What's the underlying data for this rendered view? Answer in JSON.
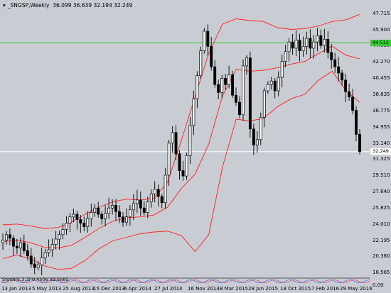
{
  "title": {
    "symbol": "_SNGSP,Weekly",
    "ohlc": "36.099 36.639 32.194 32.249"
  },
  "price_labels": [
    "47.715",
    "45.900",
    "44.090",
    "42.270",
    "40.455",
    "38.635",
    "36.775",
    "34.955",
    "33.140",
    "31.325",
    "29.510",
    "27.640",
    "25.825",
    "24.010",
    "22.195",
    "20.380",
    "18.565"
  ],
  "hline_green": {
    "label": "44.512",
    "value": 44.51,
    "color": "#33cc33"
  },
  "hline_white": {
    "label": "32.249",
    "value": 32.25,
    "color": "#ffffff"
  },
  "date_labels": [
    "13 Jan 2013",
    "5 May 2013",
    "25 Aug 2013",
    "15 Dec 2013",
    "6 Apr 2014",
    "27 Jul 2014",
    "16 Nov 2014",
    "8 Mar 2015",
    "28 Jun 2015",
    "18 Oct 2015",
    "7 Feb 2016",
    "29 May 2016"
  ],
  "indicator": {
    "label": "Stoch(5,3,3) 0.4506 33.5685",
    "zero_label": "0.00"
  },
  "colors": {
    "background": "#c9ccd2",
    "bull_candle": "#000000",
    "bear_candle": "#000000",
    "candle_body_bull": "#ffffff",
    "bands": "#ff2020",
    "wick": "#000000"
  },
  "chart_data": {
    "type": "candlestick",
    "title": "_SNGSP,Weekly",
    "ylim": [
      18.4,
      48.3
    ],
    "x": [
      "2013-01-13",
      "2016-06-19"
    ],
    "close_series": [
      22.3,
      22.9,
      22.5,
      21.6,
      21.4,
      22.0,
      21.1,
      20.5,
      19.6,
      19.2,
      19.5,
      20.3,
      20.9,
      21.2,
      21.8,
      22.4,
      22.9,
      23.5,
      24.2,
      24.9,
      25.2,
      24.6,
      24.2,
      23.8,
      24.7,
      25.4,
      25.9,
      25.2,
      24.7,
      25.3,
      25.9,
      26.2,
      25.5,
      24.9,
      24.3,
      24.9,
      25.7,
      26.4,
      26.8,
      25.9,
      25.4,
      26.6,
      27.5,
      28.0,
      27.2,
      26.5,
      29.6,
      33.2,
      34.4,
      32.0,
      30.1,
      29.5,
      31.8,
      35.2,
      38.2,
      40.8,
      43.6,
      45.8,
      44.1,
      41.8,
      39.8,
      38.9,
      40.5,
      39.8,
      40.9,
      38.6,
      37.8,
      36.4,
      41.9,
      42.8,
      34.8,
      33.0,
      33.6,
      36.1,
      39.1,
      39.8,
      40.2,
      39.1,
      40.6,
      42.4,
      43.5,
      44.6,
      43.9,
      44.8,
      43.6,
      44.1,
      45.0,
      43.9,
      44.6,
      45.3,
      44.2,
      44.9,
      43.4,
      42.6,
      41.8,
      41.1,
      40.3,
      39.0,
      38.4,
      36.9,
      34.2,
      32.25
    ],
    "bollinger_upper_approx": [
      24.0,
      24.1,
      23.9,
      23.6,
      23.7,
      24.3,
      25.2,
      26.0,
      26.6,
      26.9,
      26.8,
      27.0,
      28.8,
      33.5,
      38.4,
      43.3,
      46.6,
      47.2,
      47.0,
      46.9,
      46.2,
      46.0,
      46.1,
      46.4,
      46.9,
      47.1,
      47.7
    ],
    "bollinger_lower_approx": [
      20.2,
      20.6,
      20.2,
      19.4,
      19.0,
      19.1,
      20.0,
      21.3,
      22.2,
      22.6,
      23.0,
      23.2,
      23.3,
      22.8,
      21.0,
      22.9,
      30.5,
      35.9,
      35.7,
      36.0,
      37.3,
      38.2,
      38.7,
      40.3,
      41.3,
      39.1,
      37.8
    ],
    "bollinger_mid_approx": [
      22.1,
      22.3,
      22.0,
      21.5,
      21.4,
      21.7,
      22.6,
      23.6,
      24.4,
      24.8,
      24.9,
      25.1,
      26.0,
      28.1,
      29.7,
      33.1,
      38.5,
      41.5,
      41.3,
      41.4,
      41.7,
      42.1,
      42.4,
      43.3,
      44.1,
      43.1,
      42.7
    ],
    "horizontal_lines": [
      44.51,
      32.25
    ],
    "ylabel": "",
    "xlabel": ""
  }
}
